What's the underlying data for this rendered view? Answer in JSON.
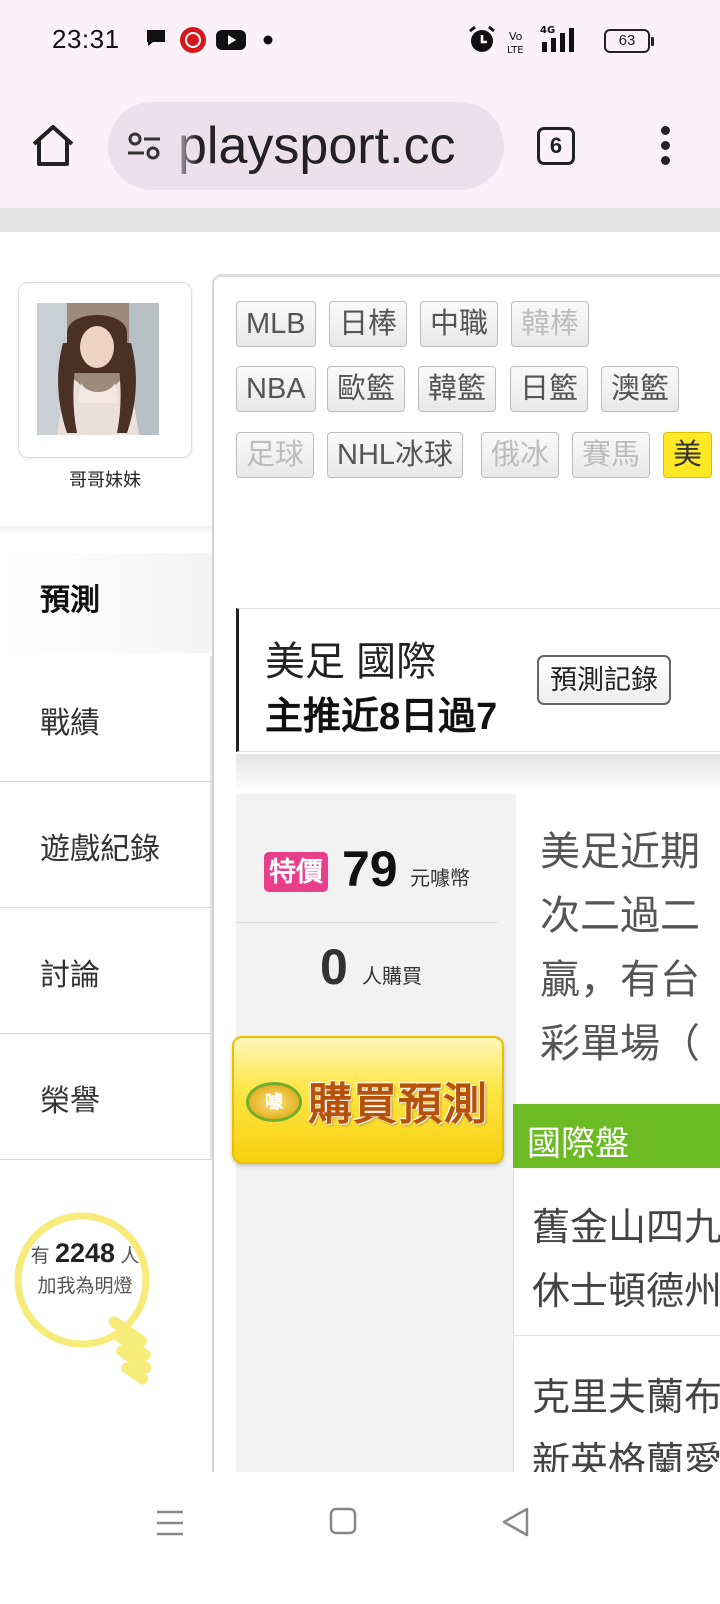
{
  "status_bar": {
    "time": "23:31",
    "battery": "63",
    "network": "4G"
  },
  "browser": {
    "url": "playsport.cc",
    "tab_count": "6"
  },
  "profile": {
    "username": "哥哥妹妹"
  },
  "sport_tags": [
    {
      "label": "MLB",
      "state": "normal"
    },
    {
      "label": "日棒",
      "state": "normal"
    },
    {
      "label": "中職",
      "state": "normal"
    },
    {
      "label": "韓棒",
      "state": "disabled"
    },
    {
      "label": "NBA",
      "state": "normal"
    },
    {
      "label": "歐籃",
      "state": "normal"
    },
    {
      "label": "韓籃",
      "state": "normal"
    },
    {
      "label": "日籃",
      "state": "normal"
    },
    {
      "label": "澳籃",
      "state": "normal"
    },
    {
      "label": "足球",
      "state": "disabled"
    },
    {
      "label": "NHL冰球",
      "state": "normal"
    },
    {
      "label": "俄冰",
      "state": "disabled"
    },
    {
      "label": "賽馬",
      "state": "disabled"
    },
    {
      "label": "美",
      "state": "active"
    }
  ],
  "nav": {
    "active": "預測",
    "items": [
      "戰績",
      "遊戲紀錄",
      "討論",
      "榮譽"
    ]
  },
  "fans": {
    "prefix": "有",
    "count": "2248",
    "suffix": "人",
    "label": "加我為明燈"
  },
  "prediction": {
    "title": "美足 國際",
    "stat": "主推近8日過7",
    "record_button": "預測記錄",
    "special_label": "特價",
    "price": "79",
    "price_unit": "元噱幣",
    "buyers_count": "0",
    "buyers_label": "人購買",
    "buy_button": "購買預測",
    "buy_logo": "噱",
    "description_lines": [
      "美足近期",
      "次二過二",
      "贏，有台",
      "彩單場（"
    ],
    "market_label": "國際盤",
    "matches": [
      {
        "line1": "舊金山四九",
        "line2": "休士頓德州"
      },
      {
        "line1": "克里夫蘭布",
        "line2": "新英格蘭愛"
      }
    ]
  },
  "colors": {
    "accent_green": "#6cbb24",
    "special_pink": "#e83e8c",
    "active_tag_yellow": "#ffe924",
    "toolbar_bg": "#fbf1f8"
  }
}
